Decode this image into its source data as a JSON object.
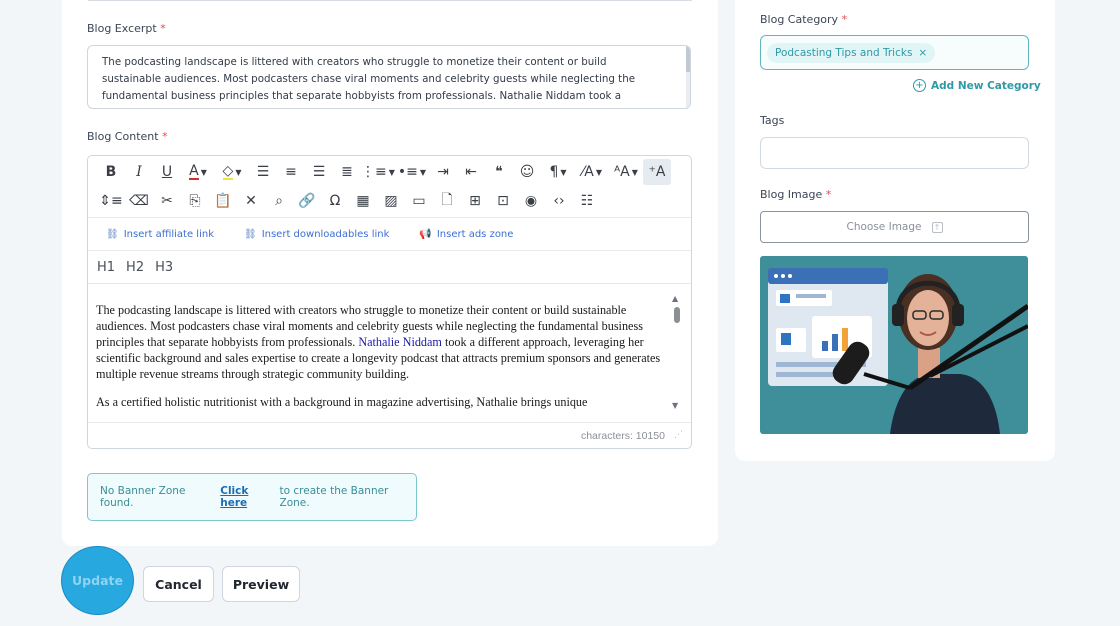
{
  "form": {
    "excerpt_label": "Blog Excerpt",
    "excerpt_text": "The podcasting landscape is littered with creators who struggle to monetize their content or build sustainable audiences. Most podcasters chase viral moments and celebrity guests while neglecting the fundamental business principles that separate hobbyists from professionals. Nathalie Niddam took a different approach, leveraging her scientific background and sales expertise to create a longevity podcast that attracts premium sponsors and generates multiple revenue streams through strategic community building.",
    "content_label": "Blog Content",
    "required_mark": "*"
  },
  "editor": {
    "toolbar_row1": [
      {
        "name": "bold-button",
        "glyph": "B",
        "cls": "tb-b"
      },
      {
        "name": "italic-button",
        "glyph": "I",
        "cls": "tb-i"
      },
      {
        "name": "underline-button",
        "glyph": "U",
        "cls": "tb-u"
      },
      {
        "name": "text-color-button",
        "glyph": "A",
        "cls": "a-red",
        "caret": true
      },
      {
        "name": "highlight-color-button",
        "glyph": "◇",
        "cls": "fill-y",
        "caret": true
      },
      {
        "name": "align-left-button",
        "glyph": "☰"
      },
      {
        "name": "align-center-button",
        "glyph": "≡"
      },
      {
        "name": "align-right-button",
        "glyph": "☰"
      },
      {
        "name": "align-justify-button",
        "glyph": "≣"
      },
      {
        "name": "ordered-list-button",
        "glyph": "⋮≡",
        "caret": true
      },
      {
        "name": "unordered-list-button",
        "glyph": "•≡",
        "caret": true
      },
      {
        "name": "indent-button",
        "glyph": "⇥"
      },
      {
        "name": "outdent-button",
        "glyph": "⇤"
      },
      {
        "name": "quote-button",
        "glyph": "❝"
      },
      {
        "name": "emoji-button",
        "glyph": "☺"
      },
      {
        "name": "paragraph-format-button",
        "glyph": "¶",
        "caret": true
      },
      {
        "name": "line-height-button",
        "glyph": "⁄A",
        "caret": true
      },
      {
        "name": "font-size-button",
        "glyph": "ᴬA",
        "caret": true
      },
      {
        "name": "clear-format-button",
        "glyph": "⁺A",
        "active": true
      }
    ],
    "toolbar_row2": [
      {
        "name": "line-spacing-button",
        "glyph": "⇕≡"
      },
      {
        "name": "eraser-button",
        "glyph": "⌫"
      },
      {
        "name": "cut-button",
        "glyph": "✂"
      },
      {
        "name": "copy-button",
        "glyph": "⎘"
      },
      {
        "name": "paste-button",
        "glyph": "📋"
      },
      {
        "name": "remove-button",
        "glyph": "✕"
      },
      {
        "name": "search-button",
        "glyph": "⌕"
      },
      {
        "name": "link-button",
        "glyph": "🔗"
      },
      {
        "name": "special-char-button",
        "glyph": "Ω"
      },
      {
        "name": "table-button",
        "glyph": "▦"
      },
      {
        "name": "image-button",
        "glyph": "▨"
      },
      {
        "name": "video-button",
        "glyph": "▭"
      },
      {
        "name": "file-button",
        "glyph": "🗋"
      },
      {
        "name": "template-button",
        "glyph": "⊞"
      },
      {
        "name": "embed-button",
        "glyph": "⊡"
      },
      {
        "name": "preview-eye-button",
        "glyph": "◉"
      },
      {
        "name": "code-view-button",
        "glyph": "‹›"
      },
      {
        "name": "select-all-button",
        "glyph": "☷"
      }
    ],
    "insert_affiliate": "Insert affiliate link",
    "insert_downloadables": "Insert downloadables link",
    "insert_ads": "Insert ads zone",
    "h1": "H1",
    "h2": "H2",
    "h3": "H3",
    "para1_a": "The podcasting landscape is littered with creators who struggle to monetize their content or build sustainable audiences. Most podcasters chase viral moments and celebrity guests while neglecting the fundamental business principles that separate hobbyists from professionals.",
    "para1_link": "Nathalie Niddam",
    "para1_b": "took a different approach, leveraging her scientific background and sales expertise to create a longevity podcast that attracts premium sponsors and generates multiple revenue streams through strategic community building.",
    "para2": "As a certified holistic nutritionist with a background in magazine advertising, Nathalie brings unique",
    "char_count": "characters: 10150"
  },
  "banner": {
    "prefix": "No Banner Zone found.",
    "link": "Click here",
    "suffix": "to create the Banner Zone."
  },
  "actions": {
    "update": "Update",
    "cancel": "Cancel",
    "preview": "Preview"
  },
  "sidebar": {
    "category_label": "Blog Category",
    "category_chip": "Podcasting Tips and Tricks",
    "chip_remove": "×",
    "add_category": "Add New Category",
    "tags_label": "Tags",
    "image_label": "Blog Image",
    "choose_image": "Choose Image"
  },
  "colors": {
    "accent": "#27a8df",
    "teal": "#2e9aa6",
    "required": "#e5484d",
    "image_bg": "#3f8f9a"
  }
}
